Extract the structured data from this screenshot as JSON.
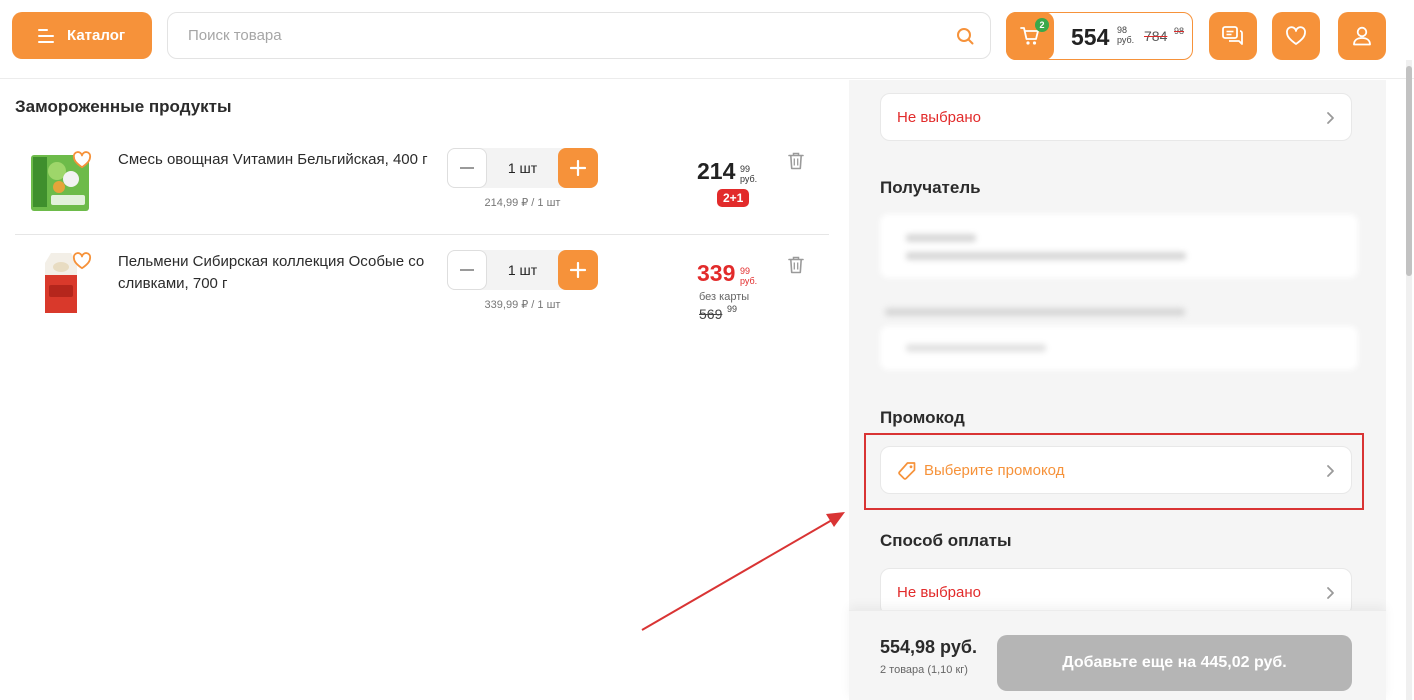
{
  "header": {
    "catalog_label": "Каталог",
    "search_placeholder": "Поиск товара",
    "cart": {
      "count": "2",
      "total_rub": "554",
      "total_kop": "98",
      "currency": "руб.",
      "old_rub": "784",
      "old_kop": "98"
    }
  },
  "section_title": "Замороженные продукты",
  "items": [
    {
      "name": "Смесь овощная Vитамин Бельгийская, 400 г",
      "qty": "1 шт",
      "unit_price": "214,99 ₽ / 1 шт",
      "price_rub": "214",
      "price_kop": "99",
      "currency": "руб.",
      "promo": "2+1",
      "price_color": "#222222"
    },
    {
      "name": "Пельмени Сибирская коллекция Особые со сливками, 700 г",
      "qty": "1 шт",
      "unit_price": "339,99 ₽ / 1 шт",
      "price_rub": "339",
      "price_kop": "99",
      "currency": "руб.",
      "no_card_label": "без карты",
      "old_rub": "569",
      "old_kop": "99",
      "price_color": "#e22b2b"
    }
  ],
  "checkout": {
    "delivery_value": "Не выбрано",
    "recipient_title": "Получатель",
    "promo_title": "Промокод",
    "promo_select": "Выберите промокод",
    "payment_title": "Способ оплаты",
    "payment_value": "Не выбрано",
    "total": "554,98 руб.",
    "total_sub": "2 товара (1,10 кг)",
    "add_more_button": "Добавьте еще на 445,02 руб."
  },
  "colors": {
    "accent": "#f6923a",
    "danger": "#e22b2b",
    "badge_green": "#3aa84a",
    "disabled_button": "#b5b5b5"
  }
}
